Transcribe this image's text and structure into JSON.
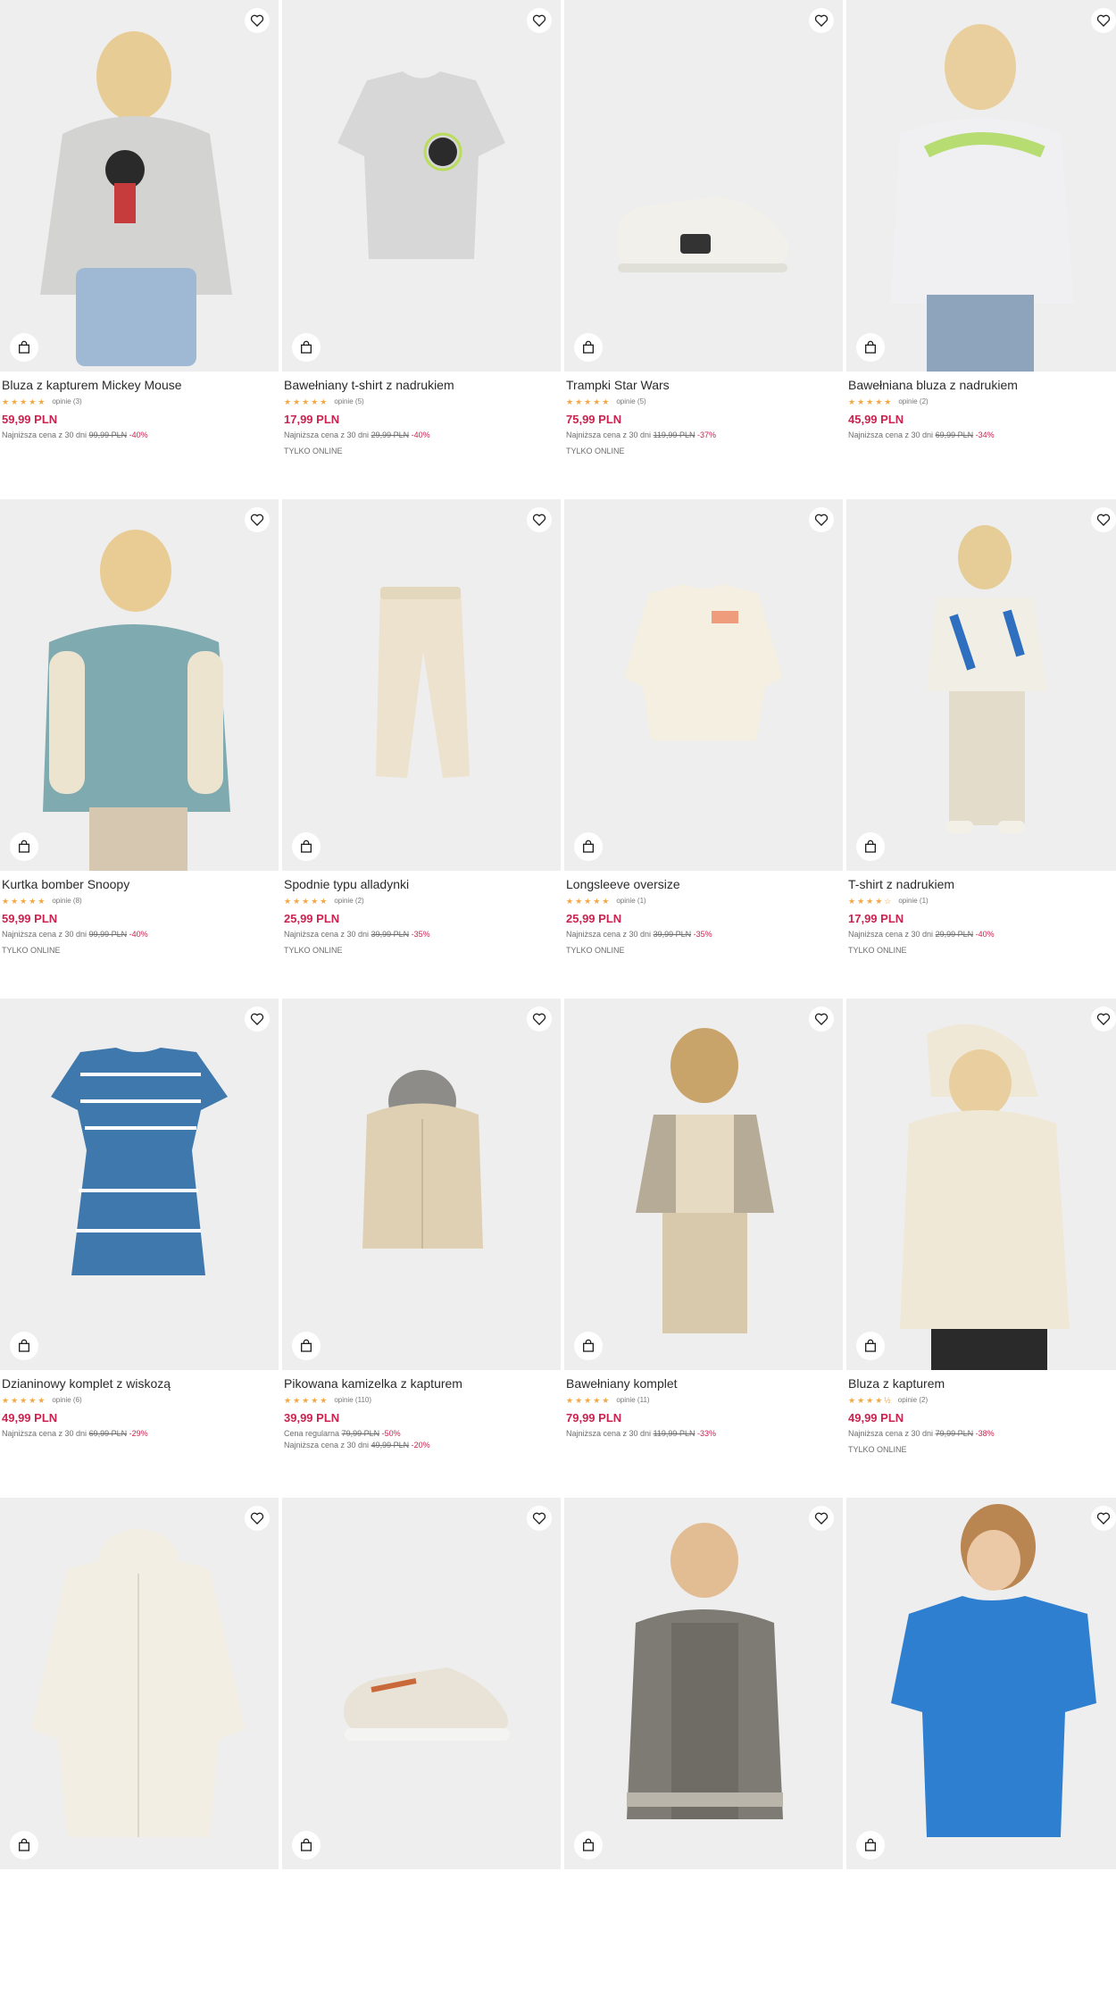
{
  "products": [
    {
      "name": "Bluza z kapturem Mickey Mouse",
      "reviews": "opinie (3)",
      "price": "59,99 PLN",
      "lowest_label": "Najniższa cena z 30 dni",
      "lowest_old": "99,99 PLN",
      "lowest_disc": "-40%",
      "online": ""
    },
    {
      "name": "Bawełniany t-shirt z nadrukiem",
      "reviews": "opinie (5)",
      "price": "17,99 PLN",
      "lowest_label": "Najniższa cena z 30 dni",
      "lowest_old": "29,99 PLN",
      "lowest_disc": "-40%",
      "online": "TYLKO ONLINE"
    },
    {
      "name": "Trampki Star Wars",
      "reviews": "opinie (5)",
      "price": "75,99 PLN",
      "lowest_label": "Najniższa cena z 30 dni",
      "lowest_old": "119,99 PLN",
      "lowest_disc": "-37%",
      "online": "TYLKO ONLINE"
    },
    {
      "name": "Bawełniana bluza z nadrukiem",
      "reviews": "opinie (2)",
      "price": "45,99 PLN",
      "lowest_label": "Najniższa cena z 30 dni",
      "lowest_old": "69,99 PLN",
      "lowest_disc": "-34%",
      "online": ""
    },
    {
      "name": "Kurtka bomber Snoopy",
      "reviews": "opinie (8)",
      "price": "59,99 PLN",
      "lowest_label": "Najniższa cena z 30 dni",
      "lowest_old": "99,99 PLN",
      "lowest_disc": "-40%",
      "online": "TYLKO ONLINE"
    },
    {
      "name": "Spodnie typu alladynki",
      "reviews": "opinie (2)",
      "price": "25,99 PLN",
      "lowest_label": "Najniższa cena z 30 dni",
      "lowest_old": "39,99 PLN",
      "lowest_disc": "-35%",
      "online": "TYLKO ONLINE"
    },
    {
      "name": "Longsleeve oversize",
      "reviews": "opinie (1)",
      "price": "25,99 PLN",
      "lowest_label": "Najniższa cena z 30 dni",
      "lowest_old": "39,99 PLN",
      "lowest_disc": "-35%",
      "online": "TYLKO ONLINE"
    },
    {
      "name": "T-shirt z nadrukiem",
      "reviews": "opinie (1)",
      "price": "17,99 PLN",
      "lowest_label": "Najniższa cena z 30 dni",
      "lowest_old": "29,99 PLN",
      "lowest_disc": "-40%",
      "online": "TYLKO ONLINE"
    },
    {
      "name": "Dzianinowy komplet z wiskozą",
      "reviews": "opinie (6)",
      "price": "49,99 PLN",
      "lowest_label": "Najniższa cena z 30 dni",
      "lowest_old": "69,99 PLN",
      "lowest_disc": "-29%",
      "online": ""
    },
    {
      "name": "Pikowana kamizelka z kapturem",
      "reviews": "opinie (110)",
      "price": "39,99 PLN",
      "regular_label": "Cena regularna",
      "regular_old": "79,99 PLN",
      "regular_disc": "-50%",
      "lowest_label": "Najniższa cena z 30 dni",
      "lowest_old": "49,99 PLN",
      "lowest_disc": "-20%",
      "online": ""
    },
    {
      "name": "Bawełniany komplet",
      "reviews": "opinie (11)",
      "price": "79,99 PLN",
      "lowest_label": "Najniższa cena z 30 dni",
      "lowest_old": "119,99 PLN",
      "lowest_disc": "-33%",
      "online": ""
    },
    {
      "name": "Bluza z kapturem",
      "reviews": "opinie (2)",
      "price": "49,99 PLN",
      "lowest_label": "Najniższa cena z 30 dni",
      "lowest_old": "79,99 PLN",
      "lowest_disc": "-38%",
      "online": "TYLKO ONLINE"
    },
    {
      "name": "",
      "reviews": "",
      "price": "",
      "lowest_label": "",
      "lowest_old": "",
      "lowest_disc": "",
      "online": ""
    },
    {
      "name": "",
      "reviews": "",
      "price": "",
      "lowest_label": "",
      "lowest_old": "",
      "lowest_disc": "",
      "online": ""
    },
    {
      "name": "",
      "reviews": "",
      "price": "",
      "lowest_label": "",
      "lowest_old": "",
      "lowest_disc": "",
      "online": ""
    },
    {
      "name": "",
      "reviews": "",
      "price": "",
      "lowest_label": "",
      "lowest_old": "",
      "lowest_disc": "",
      "online": ""
    }
  ],
  "ratings": [
    5,
    5,
    5,
    5,
    5,
    5,
    5,
    4,
    5,
    5,
    5,
    4.5
  ],
  "icons": {
    "favorite": "heart-icon",
    "cart": "shopping-bag-icon",
    "rating": "star-icon"
  },
  "colors": {
    "price": "#c9244f",
    "discount": "#c9244f",
    "star": "#f5a742",
    "image_bg": "#eeeeef"
  }
}
